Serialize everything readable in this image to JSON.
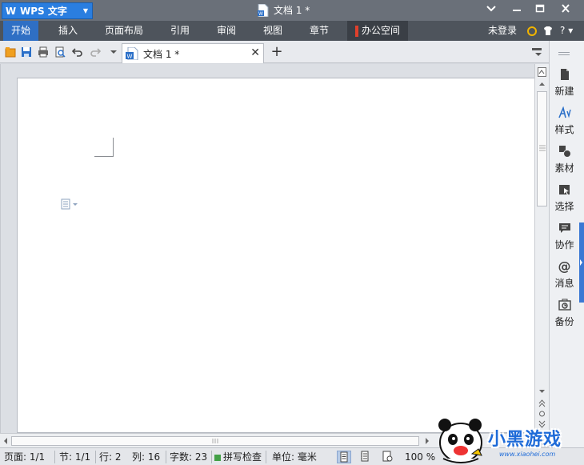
{
  "app": {
    "name": "WPS 文字",
    "logo_letter": "W"
  },
  "window": {
    "title": "文档 1 *",
    "controls": [
      "chevron-down",
      "minimize",
      "maximize",
      "close"
    ]
  },
  "menu": {
    "items": [
      "开始",
      "插入",
      "页面布局",
      "引用",
      "审阅",
      "视图",
      "章节",
      "办公空间"
    ],
    "active_index": 0,
    "login": "未登录",
    "help": "?"
  },
  "tabs": [
    {
      "label": "文档 1 *",
      "close": "✕"
    }
  ],
  "new_tab": "+",
  "side_panel": {
    "items": [
      "新建",
      "样式",
      "素材",
      "选择",
      "协作",
      "消息",
      "备份"
    ],
    "message_glyph": "@"
  },
  "status": {
    "page": "页面: 1/1",
    "section": "节: 1/1",
    "row": "行: 2",
    "col": "列: 16",
    "words": "字数: 23",
    "spell": "拼写检查",
    "unit": "单位: 毫米",
    "zoom": "100 %"
  },
  "watermark": {
    "text": "小黑游戏",
    "url": "www.xiaohei.com"
  },
  "colors": {
    "accent": "#2a7ee0",
    "menu_active": "#2f6fc4",
    "title_bg": "#6a7079",
    "menu_bg": "#4e545c",
    "side_accent": "#3a78d4"
  }
}
